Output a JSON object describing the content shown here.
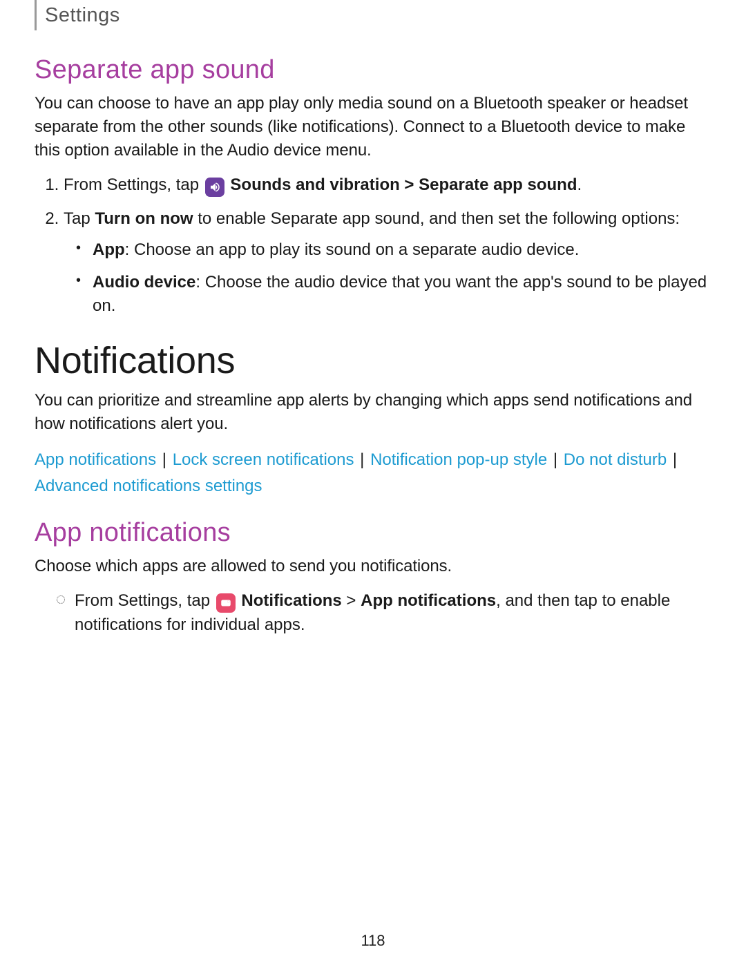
{
  "section_tab": "Settings",
  "separate": {
    "heading": "Separate app sound",
    "intro": "You can choose to have an app play only media sound on a Bluetooth speaker or headset separate from the other sounds (like notifications). Connect to a Bluetooth device to make this option available in the Audio device menu.",
    "step1_pre": "From Settings, tap ",
    "step1_bold": " Sounds and vibration > Separate app sound",
    "step1_post": ".",
    "step2_pre": "Tap ",
    "step2_bold": "Turn on now",
    "step2_post": " to enable Separate app sound, and then set the following options:",
    "bullet1_bold": "App",
    "bullet1_rest": ": Choose an app to play its sound on a separate audio device.",
    "bullet2_bold": "Audio device",
    "bullet2_rest": ": Choose the audio device that you want the app's sound to be played on."
  },
  "notifications": {
    "heading": "Notifications",
    "intro": "You can prioritize and streamline app alerts by changing which apps send notifications and how notifications alert you.",
    "links": {
      "l1": "App notifications",
      "l2": "Lock screen notifications",
      "l3": "Notification pop-up style",
      "l4": "Do not disturb",
      "l5": "Advanced notifications settings"
    },
    "sep": "|"
  },
  "app_notifications": {
    "heading": "App notifications",
    "intro": "Choose which apps are allowed to send you notifications.",
    "step_pre": "From Settings, tap ",
    "step_bold1": " Notifications",
    "step_mid": " > ",
    "step_bold2": "App notifications",
    "step_post": ", and then tap to enable notifications for individual apps."
  },
  "page_number": "118"
}
